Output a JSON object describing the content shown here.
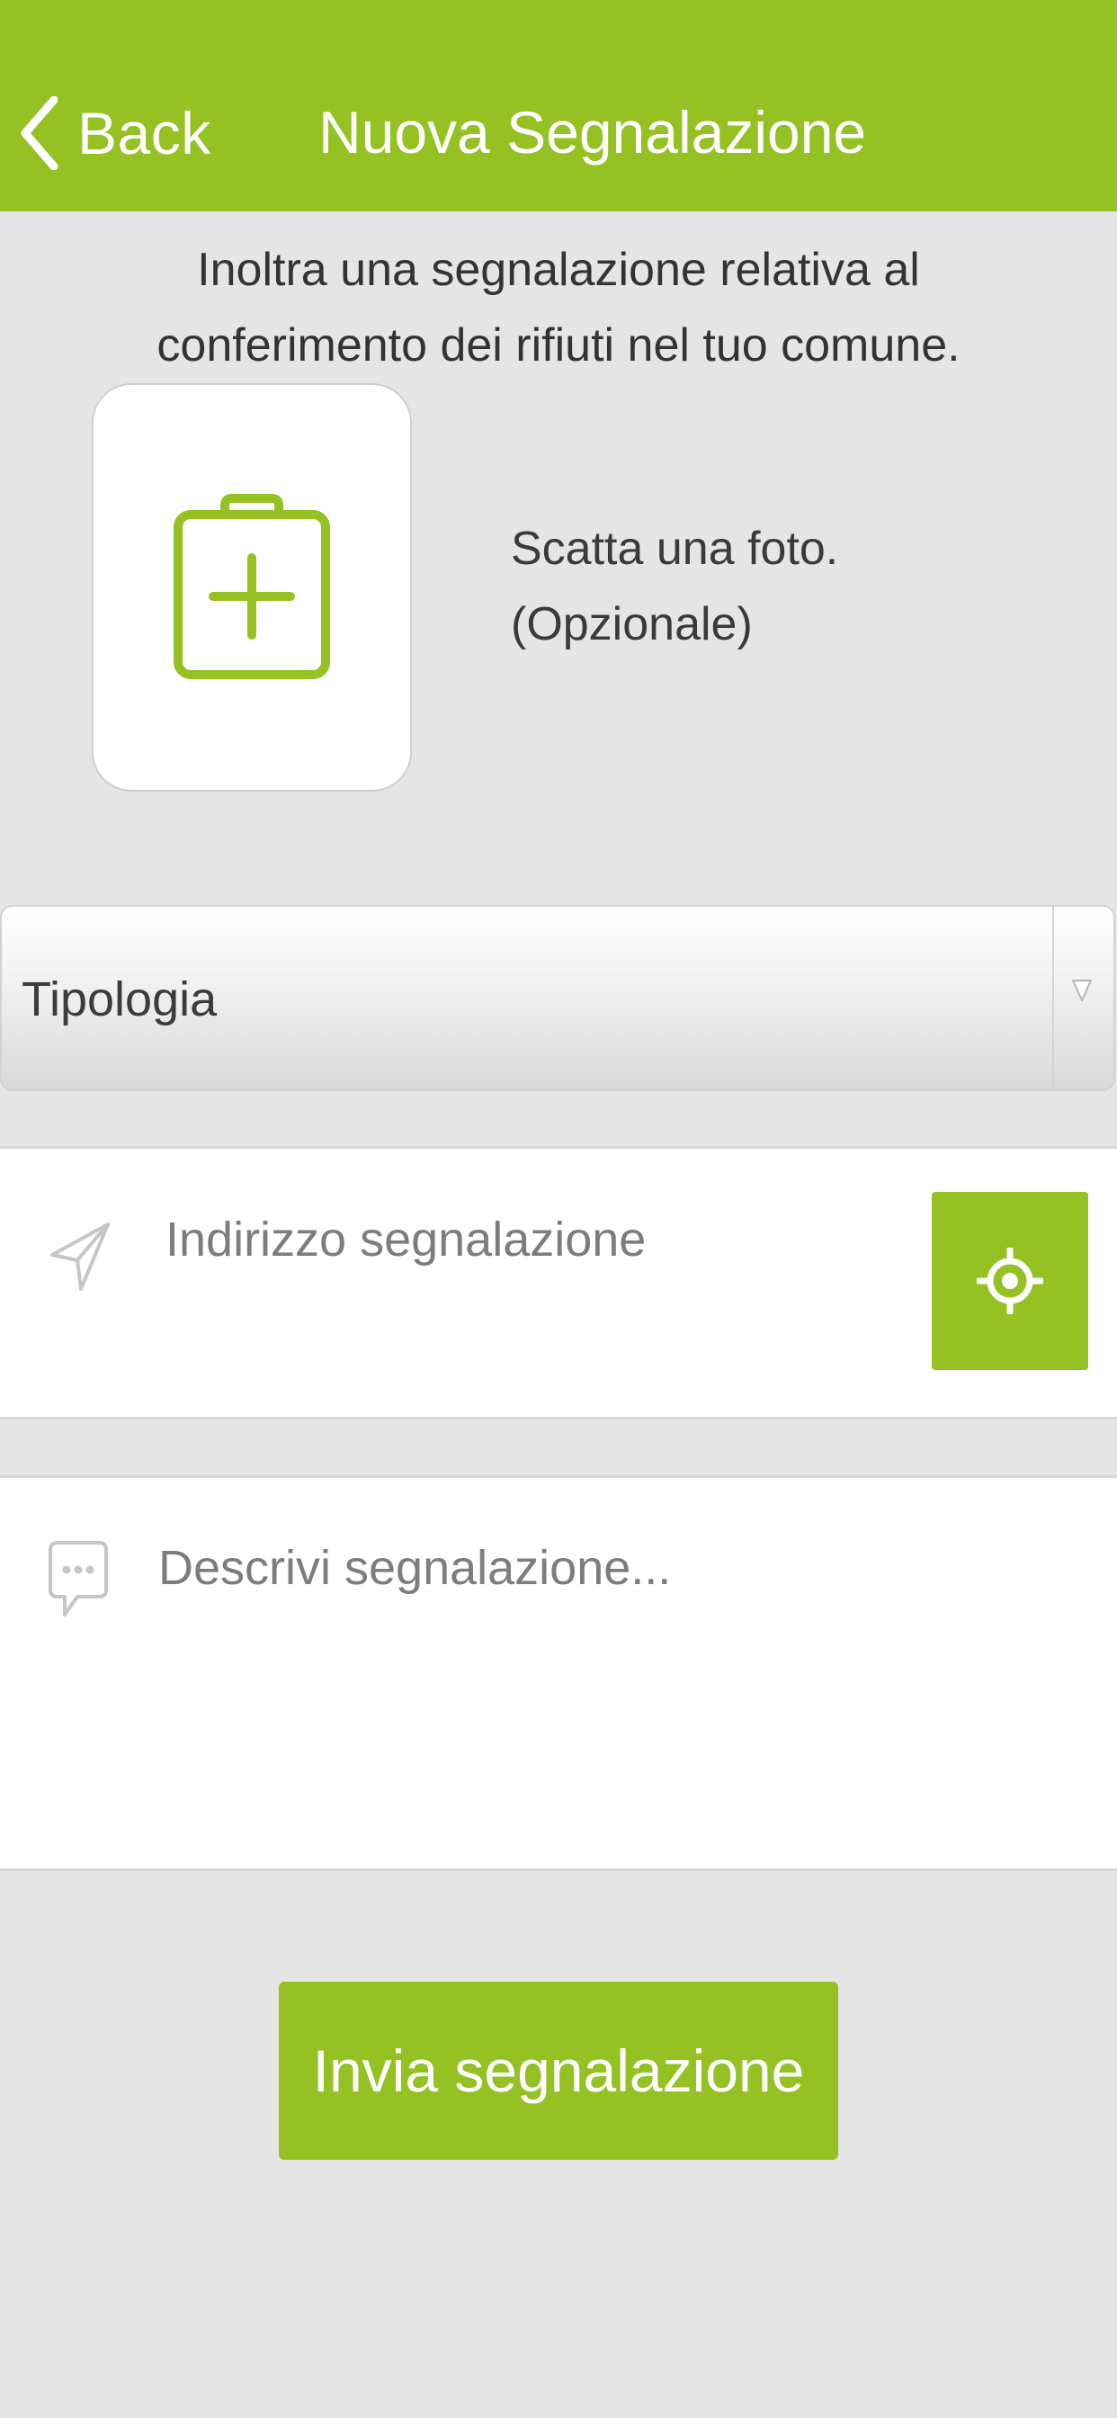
{
  "header": {
    "back_label": "Back",
    "title": "Nuova Segnalazione"
  },
  "intro": {
    "line1": "Inoltra una segnalazione relativa al",
    "line2": "conferimento dei rifiuti nel tuo comune."
  },
  "photo": {
    "icon": "camera-add-icon",
    "hint_line1": "Scatta una foto.",
    "hint_line2": "(Opzionale)"
  },
  "type_select": {
    "selected": "Tipologia",
    "arrow_icon": "chevron-down-icon"
  },
  "address": {
    "icon": "navigation-arrow-icon",
    "placeholder": "Indirizzo segnalazione",
    "value": "",
    "locate_icon": "crosshair-icon"
  },
  "description": {
    "icon": "chat-bubble-icon",
    "placeholder": "Descrivi segnalazione...",
    "value": ""
  },
  "submit": {
    "label": "Invia segnalazione"
  },
  "colors": {
    "accent": "#95c122",
    "background": "#e5e5e5",
    "panel": "#ffffff"
  }
}
